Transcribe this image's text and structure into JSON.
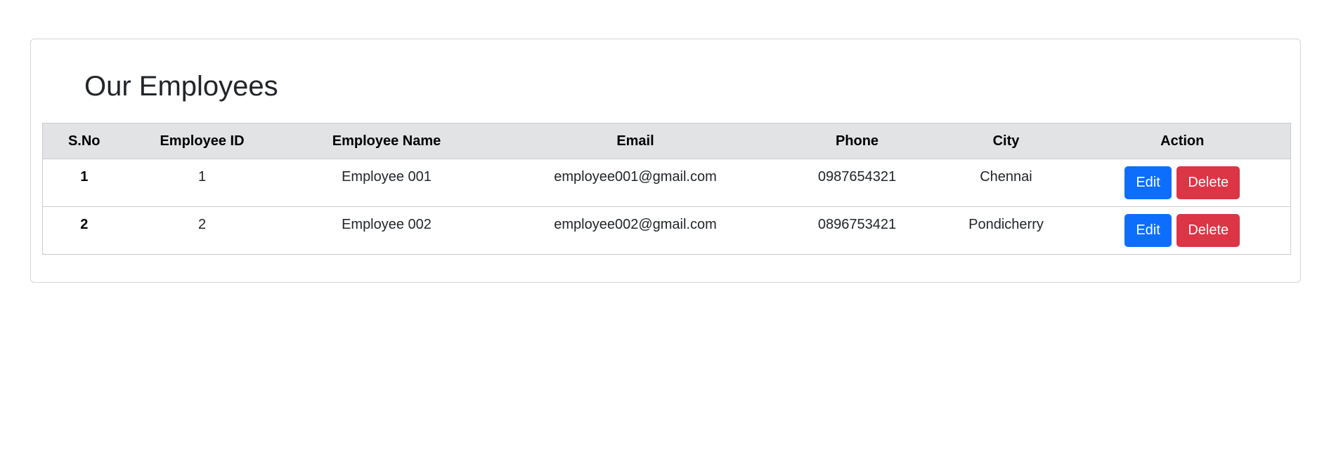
{
  "page": {
    "title": "Our Employees"
  },
  "table": {
    "headers": [
      "S.No",
      "Employee ID",
      "Employee Name",
      "Email",
      "Phone",
      "City",
      "Action"
    ],
    "rows": [
      {
        "sno": "1",
        "employee_id": "1",
        "name": "Employee 001",
        "email": "employee001@gmail.com",
        "phone": "0987654321",
        "city": "Chennai",
        "edit_label": "Edit",
        "delete_label": "Delete"
      },
      {
        "sno": "2",
        "employee_id": "2",
        "name": "Employee 002",
        "email": "employee002@gmail.com",
        "phone": "0896753421",
        "city": "Pondicherry",
        "edit_label": "Edit",
        "delete_label": "Delete"
      }
    ]
  },
  "colors": {
    "header_bg": "#e2e3e5",
    "edit_button": "#0d6efd",
    "delete_button": "#dc3545",
    "border": "#c9ccd0"
  }
}
